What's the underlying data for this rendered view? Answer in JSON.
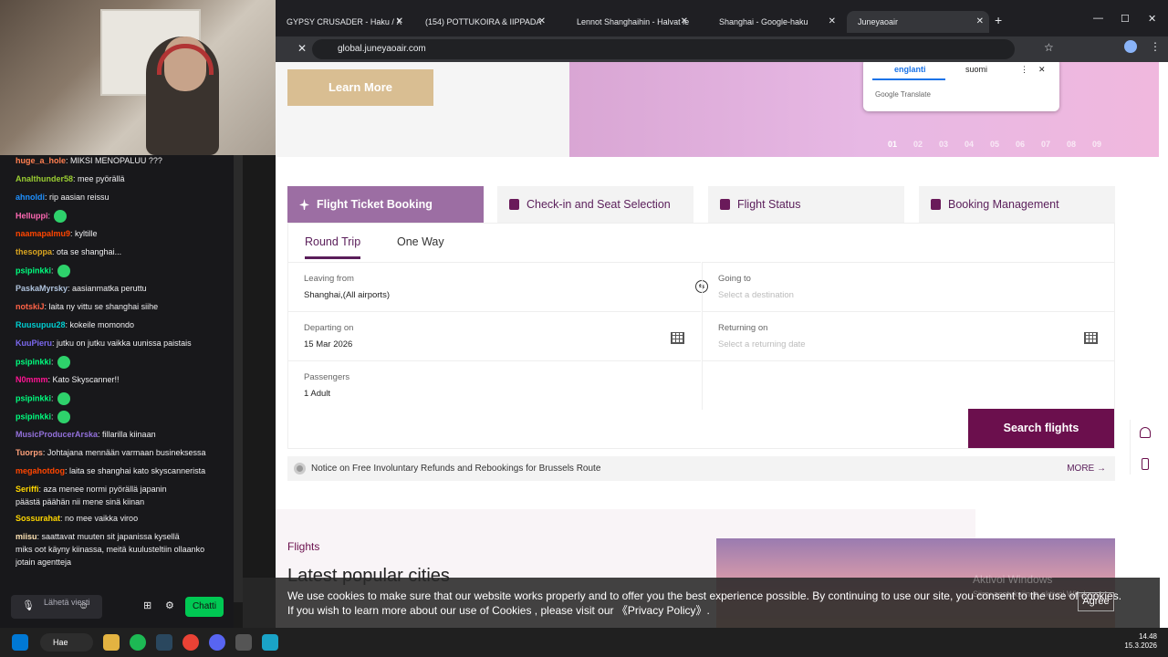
{
  "browser": {
    "tabs": [
      {
        "label": "GYPSY CRUSADER - Haku / X"
      },
      {
        "label": "(154) POTTUKOIRA & IIPPADA"
      },
      {
        "label": "Lennot Shanghaihin - Halvat le"
      },
      {
        "label": "Shanghai - Google-haku"
      },
      {
        "label": "Juneyaoair"
      }
    ],
    "url": "global.juneyaoair.com"
  },
  "translate_popup": {
    "lang_from": "englanti",
    "lang_to": "suomi",
    "brand": "Google Translate"
  },
  "hero": {
    "learn_more": "Learn More",
    "slides": [
      "01",
      "02",
      "03",
      "04",
      "05",
      "06",
      "07",
      "08",
      "09"
    ]
  },
  "booking_tabs": [
    {
      "label": "Flight Ticket Booking"
    },
    {
      "label": "Check-in and Seat Selection"
    },
    {
      "label": "Flight Status"
    },
    {
      "label": "Booking Management"
    }
  ],
  "trip_types": {
    "round": "Round Trip",
    "oneway": "One Way"
  },
  "form": {
    "leaving_label": "Leaving from",
    "leaving_value": "Shanghai,(All airports)",
    "going_label": "Going to",
    "going_placeholder": "Select a destination",
    "depart_label": "Departing on",
    "depart_value": "15 Mar 2026",
    "return_label": "Returning on",
    "return_placeholder": "Select a returning date",
    "pax_label": "Passengers",
    "pax_value": "1 Adult",
    "search": "Search flights"
  },
  "notice": {
    "text": "Notice on Free Involuntary Refunds and Rebookings for Brussels Route",
    "more": "MORE →"
  },
  "section": {
    "flights": "Flights",
    "latest": "Latest popular cities"
  },
  "cookie": {
    "text1": "We use cookies to make sure that our website works properly and to offer you the best experience possible. By continuing to use our site, you consent to the use of cookies.",
    "text2": "If you wish to learn more about our use of Cookies , please visit our 《Privacy Policy》.",
    "agree": "Agree",
    "watermark1": "Aktivoi Windows",
    "watermark2": "Siirry asetuksiin ja aktivoi Windows."
  },
  "chat": {
    "messages": [
      {
        "user": "huge_a_hole",
        "text": ": MIKSI MENOPALUU ???",
        "color": "#ff7f50"
      },
      {
        "user": "Analthunder58",
        "text": ": mee pyörällä",
        "color": "#9acd32"
      },
      {
        "user": "ahnoldi",
        "text": ": rip aasian reissu",
        "color": "#1e90ff"
      },
      {
        "user": "Helluppi",
        "text": ":",
        "color": "#ff69b4"
      },
      {
        "user": "naamapalmu9",
        "text": ": kyltille",
        "color": "#ff4500"
      },
      {
        "user": "thesoppa",
        "text": ": ota se shanghai...",
        "color": "#daa520"
      },
      {
        "user": "psipinkki",
        "text": ":",
        "color": "#00ff7f"
      },
      {
        "user": "PaskaMyrsky",
        "text": ": aasianmatka peruttu",
        "color": "#b0c4de"
      },
      {
        "user": "notskiJ",
        "text": ": laita ny vittu se shanghai siihe",
        "color": "#ff6347"
      },
      {
        "user": "Ruusupuu28",
        "text": ": kokeile momondo",
        "color": "#00ced1"
      },
      {
        "user": "KuuPieru",
        "text": ": jutku on jutku vaikka uunissa paistais",
        "color": "#7b68ee"
      },
      {
        "user": "psipinkki",
        "text": ":",
        "color": "#00ff7f"
      },
      {
        "user": "N0mmm",
        "text": ": Kato Skyscanner!!",
        "color": "#ff1493"
      },
      {
        "user": "psipinkki",
        "text": ":",
        "color": "#00ff7f"
      },
      {
        "user": "psipinkki",
        "text": ":",
        "color": "#00ff7f"
      },
      {
        "user": "MusicProducerArska",
        "text": ": fillarilla kiinaan",
        "color": "#9370db"
      },
      {
        "user": "Tuorps",
        "text": ": Johtajana mennään varmaan busineksessa",
        "color": "#ffa07a"
      },
      {
        "user": "megahotdog",
        "text": ": laita se shanghai kato skyscannerista",
        "color": "#ff4500"
      },
      {
        "user": "Seriffi",
        "text": ": aza menee normi pyörällä japanin",
        "color": "#ffd700"
      },
      {
        "user": "",
        "text": "päästä päähän nii mene sinä kiinan",
        "color": "#efeff1"
      },
      {
        "user": "Sossurahat",
        "text": ": no mee vaikka viroo",
        "color": "#ffd700"
      },
      {
        "user": "miisu",
        "text": ": saattavat muuten sit japanissa kysellä",
        "color": "#ffe4b5"
      },
      {
        "user": "",
        "text": "miks oot käyny kiinassa, meitä kuulusteltiin ollaanko",
        "color": "#efeff1"
      },
      {
        "user": "",
        "text": "jotain agenttej​a",
        "color": "#efeff1"
      }
    ],
    "input_placeholder": "Lähetä viesti",
    "send": "Chatti"
  },
  "taskbar": {
    "search": "Hae",
    "time": "14.48",
    "date": "15.3.2026"
  },
  "colors": {
    "brand": "#6b0f4d",
    "active_tab": "#9c6ea3",
    "learn_more": "#d9be92"
  }
}
